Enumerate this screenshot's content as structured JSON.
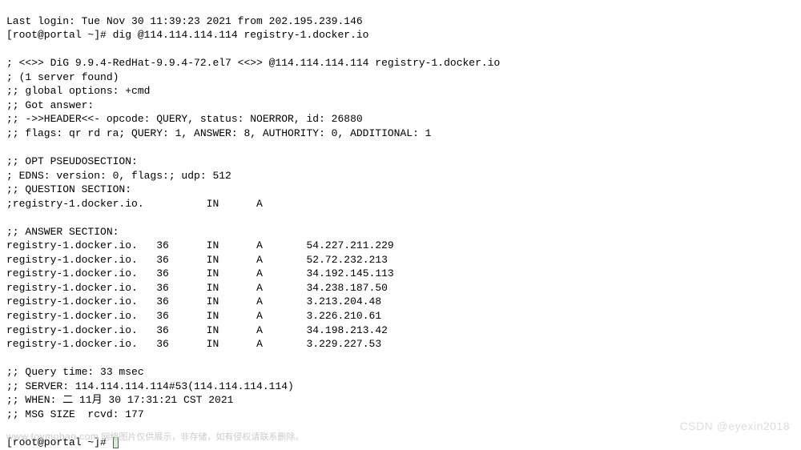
{
  "login": {
    "last_login": "Last login: Tue Nov 30 11:39:23 2021 from 202.195.239.146"
  },
  "prompt1": {
    "user_host": "[root@portal ~]# ",
    "command": "dig @114.114.114.114 registry-1.docker.io"
  },
  "dig": {
    "banner": "; <<>> DiG 9.9.4-RedHat-9.9.4-72.el7 <<>> @114.114.114.114 registry-1.docker.io",
    "server_found": "; (1 server found)",
    "global_options": ";; global options: +cmd",
    "got_answer": ";; Got answer:",
    "header": ";; ->>HEADER<<- opcode: QUERY, status: NOERROR, id: 26880",
    "flags": ";; flags: qr rd ra; QUERY: 1, ANSWER: 8, AUTHORITY: 0, ADDITIONAL: 1",
    "opt_header": ";; OPT PSEUDOSECTION:",
    "edns": "; EDNS: version: 0, flags:; udp: 512",
    "question_header": ";; QUESTION SECTION:",
    "question_row": ";registry-1.docker.io.          IN      A",
    "answer_header": ";; ANSWER SECTION:",
    "answers": [
      {
        "name": "registry-1.docker.io.",
        "ttl": "36",
        "class": "IN",
        "type": "A",
        "addr": "54.227.211.229"
      },
      {
        "name": "registry-1.docker.io.",
        "ttl": "36",
        "class": "IN",
        "type": "A",
        "addr": "52.72.232.213"
      },
      {
        "name": "registry-1.docker.io.",
        "ttl": "36",
        "class": "IN",
        "type": "A",
        "addr": "34.192.145.113"
      },
      {
        "name": "registry-1.docker.io.",
        "ttl": "36",
        "class": "IN",
        "type": "A",
        "addr": "34.238.187.50"
      },
      {
        "name": "registry-1.docker.io.",
        "ttl": "36",
        "class": "IN",
        "type": "A",
        "addr": "3.213.204.48"
      },
      {
        "name": "registry-1.docker.io.",
        "ttl": "36",
        "class": "IN",
        "type": "A",
        "addr": "3.226.210.61"
      },
      {
        "name": "registry-1.docker.io.",
        "ttl": "36",
        "class": "IN",
        "type": "A",
        "addr": "34.198.213.42"
      },
      {
        "name": "registry-1.docker.io.",
        "ttl": "36",
        "class": "IN",
        "type": "A",
        "addr": "3.229.227.53"
      }
    ],
    "query_time": ";; Query time: 33 msec",
    "server": ";; SERVER: 114.114.114.114#53(114.114.114.114)",
    "when": ";; WHEN: 二 11月 30 17:31:21 CST 2021",
    "msg_size": ";; MSG SIZE  rcvd: 177"
  },
  "prompt2": {
    "user_host": "[root@portal ~]# "
  },
  "watermark": {
    "left_domain": "www.toymoban.com",
    "left_text": " 网络图片仅供展示，非存储，如有侵权请联系删除。",
    "right": "CSDN @eyexin2018"
  }
}
